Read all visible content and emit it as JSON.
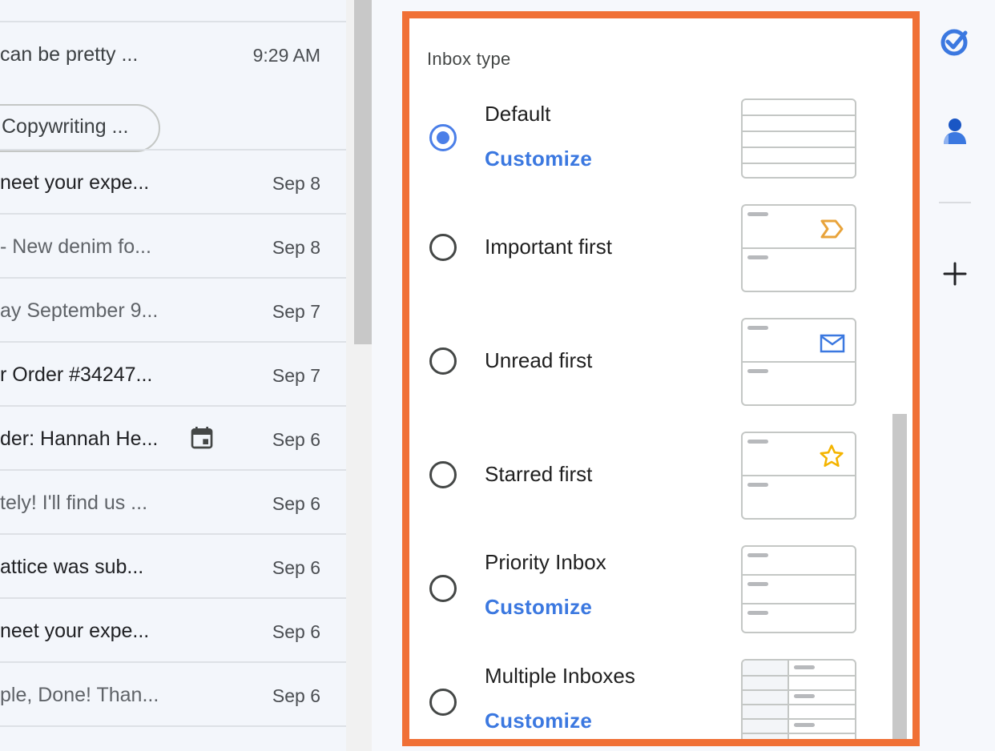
{
  "mail_list": {
    "first_row": {
      "snippet": " can be pretty ...",
      "time": "9:29 AM"
    },
    "chip_label": "Copywriting ...",
    "rows": [
      {
        "snippet": "neet your expe...",
        "date": "Sep 8"
      },
      {
        "snippet": "- New denim fo...",
        "date": "Sep 8"
      },
      {
        "snippet": "ay September 9...",
        "date": "Sep 7"
      },
      {
        "snippet": "r Order #34247...",
        "date": "Sep 7"
      },
      {
        "snippet": "der: Hannah He...",
        "date": "Sep 6"
      },
      {
        "snippet": "tely! I'll find us ...",
        "date": "Sep 6"
      },
      {
        "snippet": "attice was sub...",
        "date": "Sep 6"
      },
      {
        "snippet": "neet your expe...",
        "date": "Sep 6"
      },
      {
        "snippet": "ple, Done! Than...",
        "date": "Sep 6"
      }
    ]
  },
  "settings": {
    "section_title": "Inbox type",
    "customize_label": "Customize",
    "options": [
      {
        "label": "Default",
        "selected": true,
        "has_customize": true,
        "thumb_icon": ""
      },
      {
        "label": "Important first",
        "selected": false,
        "has_customize": false,
        "thumb_icon": "importance-marker-icon"
      },
      {
        "label": "Unread first",
        "selected": false,
        "has_customize": false,
        "thumb_icon": "envelope-icon"
      },
      {
        "label": "Starred first",
        "selected": false,
        "has_customize": false,
        "thumb_icon": "star-icon"
      },
      {
        "label": "Priority Inbox",
        "selected": false,
        "has_customize": true,
        "thumb_icon": ""
      },
      {
        "label": "Multiple Inboxes",
        "selected": false,
        "has_customize": true,
        "thumb_icon": ""
      }
    ]
  },
  "side_panel": {
    "icons": [
      "tasks-icon",
      "contacts-icon",
      "add-icon"
    ]
  },
  "colors": {
    "accent": "#3b78e0",
    "radio_selected": "#4b7fe8",
    "highlight_border": "#f07036",
    "important_marker": "#e8a33a",
    "star": "#f4b400"
  }
}
